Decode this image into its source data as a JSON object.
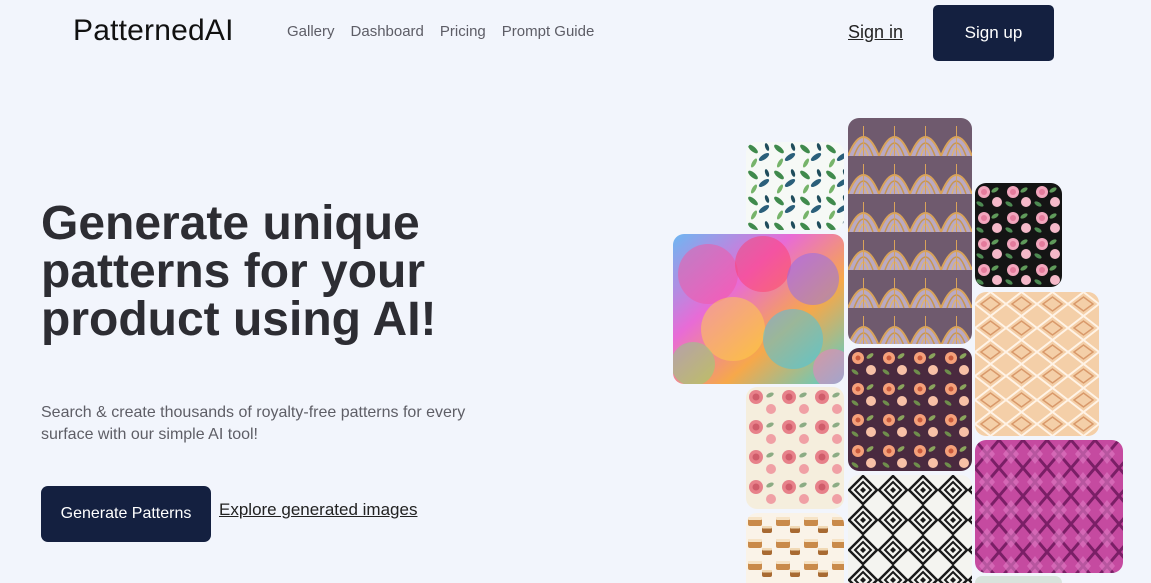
{
  "header": {
    "logo": "PatternedAI",
    "nav": [
      "Gallery",
      "Dashboard",
      "Pricing",
      "Prompt Guide"
    ],
    "signin": "Sign in",
    "signup": "Sign up"
  },
  "hero": {
    "headline": "Generate unique patterns for your product using AI!",
    "subtext": "Search & create thousands of royalty-free patterns for every surface with our simple AI tool!",
    "cta_primary": "Generate Patterns",
    "cta_secondary": "Explore generated images"
  },
  "gallery": {
    "tiles": [
      "green-leaf-pattern",
      "art-deco-fan-pattern",
      "pink-rose-on-black-pattern",
      "rainbow-bokeh-circles-pattern",
      "peach-geometric-pattern",
      "cream-rose-floral-pattern",
      "purple-floral-pattern",
      "magenta-diamond-lattice-pattern",
      "black-white-diamond-pattern",
      "pastry-pattern"
    ]
  }
}
